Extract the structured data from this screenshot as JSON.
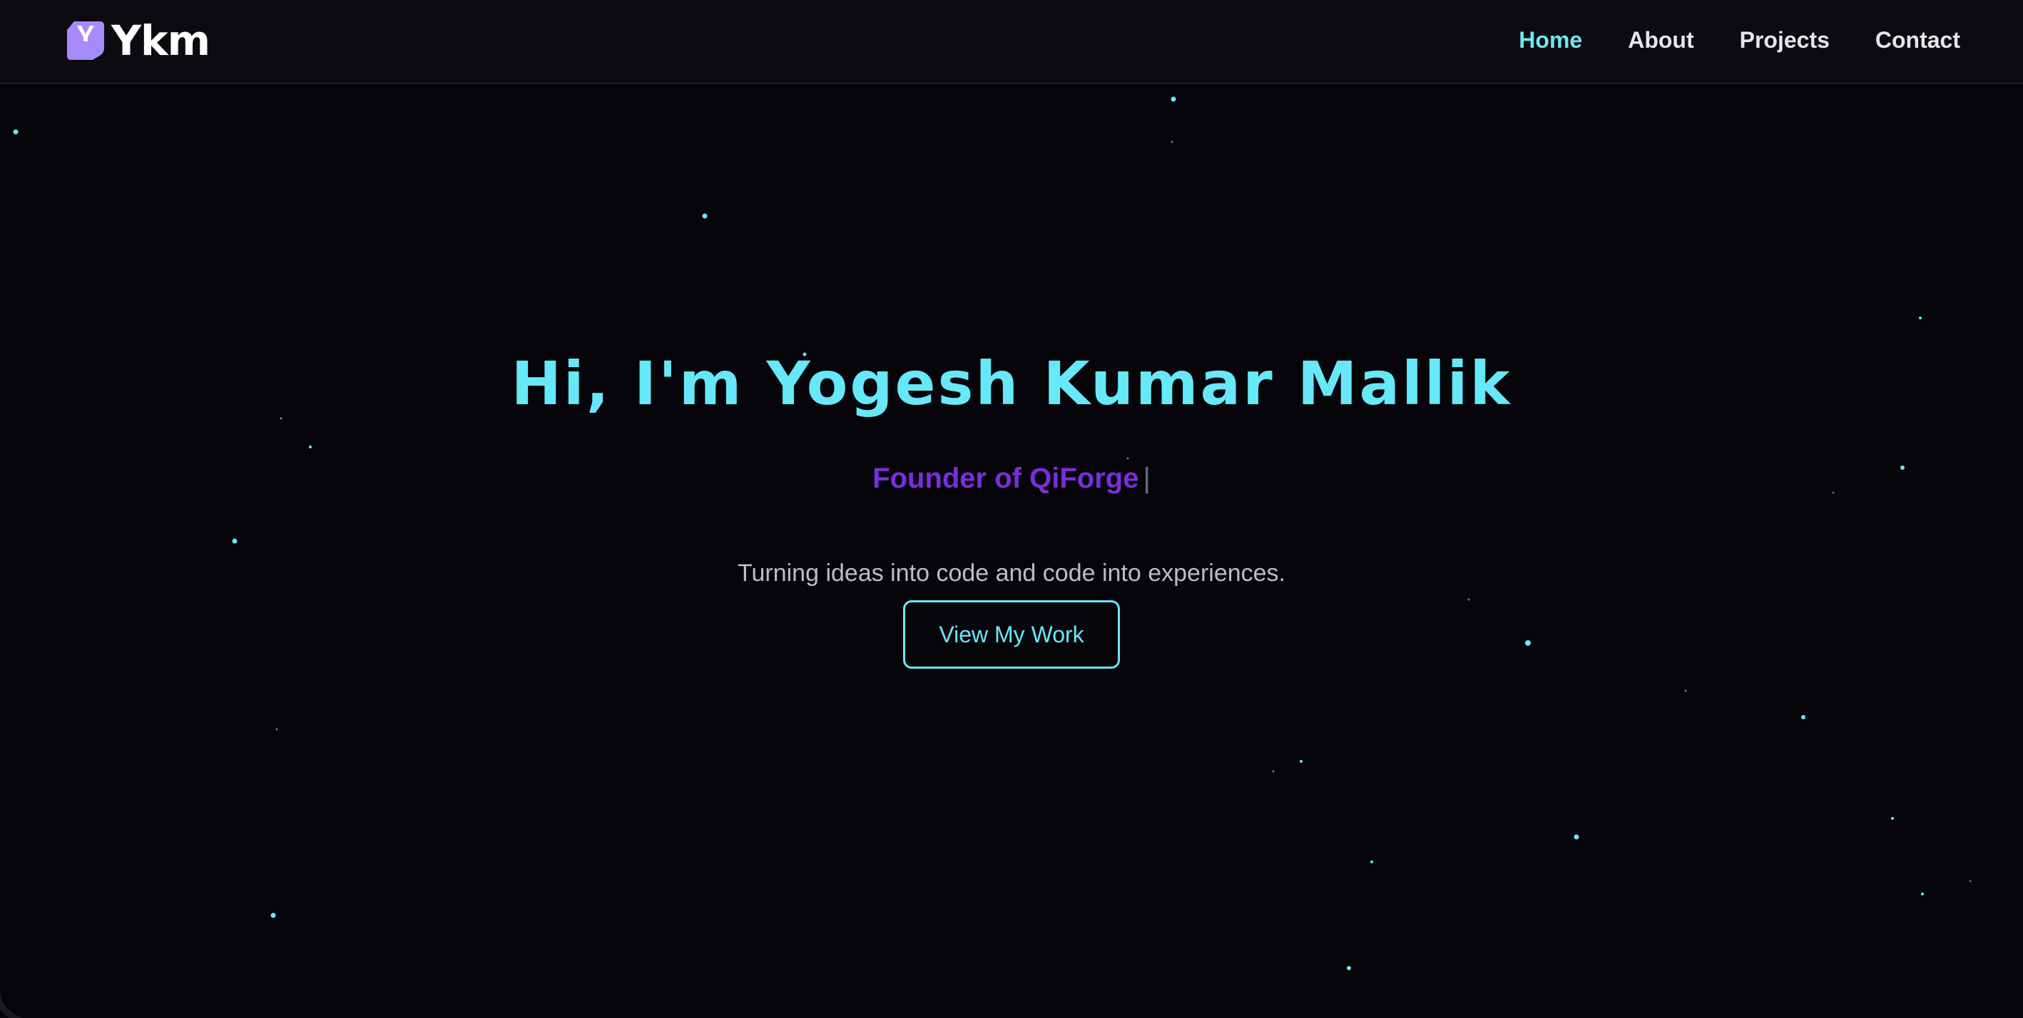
{
  "brand": {
    "name": "Ykm",
    "logo_icon": "ykm-logo-icon",
    "logo_color": "#a78bfa"
  },
  "nav": {
    "items": [
      {
        "label": "Home",
        "active": true
      },
      {
        "label": "About",
        "active": false
      },
      {
        "label": "Projects",
        "active": false
      },
      {
        "label": "Contact",
        "active": false
      }
    ]
  },
  "hero": {
    "title": "Hi, I'm Yogesh Kumar Mallik",
    "subtitle": "Founder of QiForge",
    "cursor": "|",
    "tagline": "Turning ideas into code and code into experiences.",
    "cta_label": "View My Work"
  },
  "colors": {
    "accent": "#67e8f9",
    "role": "#7c2ddb",
    "background": "#06060a",
    "star": "#67e8f9"
  }
}
